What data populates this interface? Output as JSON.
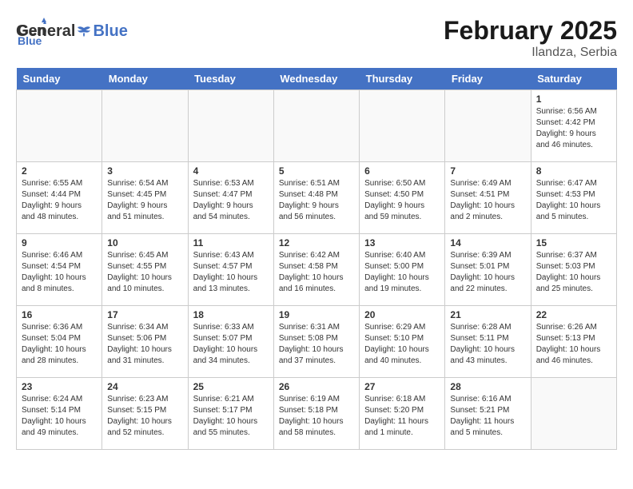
{
  "header": {
    "logo_general": "General",
    "logo_blue": "Blue",
    "title": "February 2025",
    "subtitle": "Ilandza, Serbia"
  },
  "days_of_week": [
    "Sunday",
    "Monday",
    "Tuesday",
    "Wednesday",
    "Thursday",
    "Friday",
    "Saturday"
  ],
  "weeks": [
    [
      {
        "day": "",
        "info": ""
      },
      {
        "day": "",
        "info": ""
      },
      {
        "day": "",
        "info": ""
      },
      {
        "day": "",
        "info": ""
      },
      {
        "day": "",
        "info": ""
      },
      {
        "day": "",
        "info": ""
      },
      {
        "day": "1",
        "info": "Sunrise: 6:56 AM\nSunset: 4:42 PM\nDaylight: 9 hours and 46 minutes."
      }
    ],
    [
      {
        "day": "2",
        "info": "Sunrise: 6:55 AM\nSunset: 4:44 PM\nDaylight: 9 hours and 48 minutes."
      },
      {
        "day": "3",
        "info": "Sunrise: 6:54 AM\nSunset: 4:45 PM\nDaylight: 9 hours and 51 minutes."
      },
      {
        "day": "4",
        "info": "Sunrise: 6:53 AM\nSunset: 4:47 PM\nDaylight: 9 hours and 54 minutes."
      },
      {
        "day": "5",
        "info": "Sunrise: 6:51 AM\nSunset: 4:48 PM\nDaylight: 9 hours and 56 minutes."
      },
      {
        "day": "6",
        "info": "Sunrise: 6:50 AM\nSunset: 4:50 PM\nDaylight: 9 hours and 59 minutes."
      },
      {
        "day": "7",
        "info": "Sunrise: 6:49 AM\nSunset: 4:51 PM\nDaylight: 10 hours and 2 minutes."
      },
      {
        "day": "8",
        "info": "Sunrise: 6:47 AM\nSunset: 4:53 PM\nDaylight: 10 hours and 5 minutes."
      }
    ],
    [
      {
        "day": "9",
        "info": "Sunrise: 6:46 AM\nSunset: 4:54 PM\nDaylight: 10 hours and 8 minutes."
      },
      {
        "day": "10",
        "info": "Sunrise: 6:45 AM\nSunset: 4:55 PM\nDaylight: 10 hours and 10 minutes."
      },
      {
        "day": "11",
        "info": "Sunrise: 6:43 AM\nSunset: 4:57 PM\nDaylight: 10 hours and 13 minutes."
      },
      {
        "day": "12",
        "info": "Sunrise: 6:42 AM\nSunset: 4:58 PM\nDaylight: 10 hours and 16 minutes."
      },
      {
        "day": "13",
        "info": "Sunrise: 6:40 AM\nSunset: 5:00 PM\nDaylight: 10 hours and 19 minutes."
      },
      {
        "day": "14",
        "info": "Sunrise: 6:39 AM\nSunset: 5:01 PM\nDaylight: 10 hours and 22 minutes."
      },
      {
        "day": "15",
        "info": "Sunrise: 6:37 AM\nSunset: 5:03 PM\nDaylight: 10 hours and 25 minutes."
      }
    ],
    [
      {
        "day": "16",
        "info": "Sunrise: 6:36 AM\nSunset: 5:04 PM\nDaylight: 10 hours and 28 minutes."
      },
      {
        "day": "17",
        "info": "Sunrise: 6:34 AM\nSunset: 5:06 PM\nDaylight: 10 hours and 31 minutes."
      },
      {
        "day": "18",
        "info": "Sunrise: 6:33 AM\nSunset: 5:07 PM\nDaylight: 10 hours and 34 minutes."
      },
      {
        "day": "19",
        "info": "Sunrise: 6:31 AM\nSunset: 5:08 PM\nDaylight: 10 hours and 37 minutes."
      },
      {
        "day": "20",
        "info": "Sunrise: 6:29 AM\nSunset: 5:10 PM\nDaylight: 10 hours and 40 minutes."
      },
      {
        "day": "21",
        "info": "Sunrise: 6:28 AM\nSunset: 5:11 PM\nDaylight: 10 hours and 43 minutes."
      },
      {
        "day": "22",
        "info": "Sunrise: 6:26 AM\nSunset: 5:13 PM\nDaylight: 10 hours and 46 minutes."
      }
    ],
    [
      {
        "day": "23",
        "info": "Sunrise: 6:24 AM\nSunset: 5:14 PM\nDaylight: 10 hours and 49 minutes."
      },
      {
        "day": "24",
        "info": "Sunrise: 6:23 AM\nSunset: 5:15 PM\nDaylight: 10 hours and 52 minutes."
      },
      {
        "day": "25",
        "info": "Sunrise: 6:21 AM\nSunset: 5:17 PM\nDaylight: 10 hours and 55 minutes."
      },
      {
        "day": "26",
        "info": "Sunrise: 6:19 AM\nSunset: 5:18 PM\nDaylight: 10 hours and 58 minutes."
      },
      {
        "day": "27",
        "info": "Sunrise: 6:18 AM\nSunset: 5:20 PM\nDaylight: 11 hours and 1 minute."
      },
      {
        "day": "28",
        "info": "Sunrise: 6:16 AM\nSunset: 5:21 PM\nDaylight: 11 hours and 5 minutes."
      },
      {
        "day": "",
        "info": ""
      }
    ]
  ]
}
